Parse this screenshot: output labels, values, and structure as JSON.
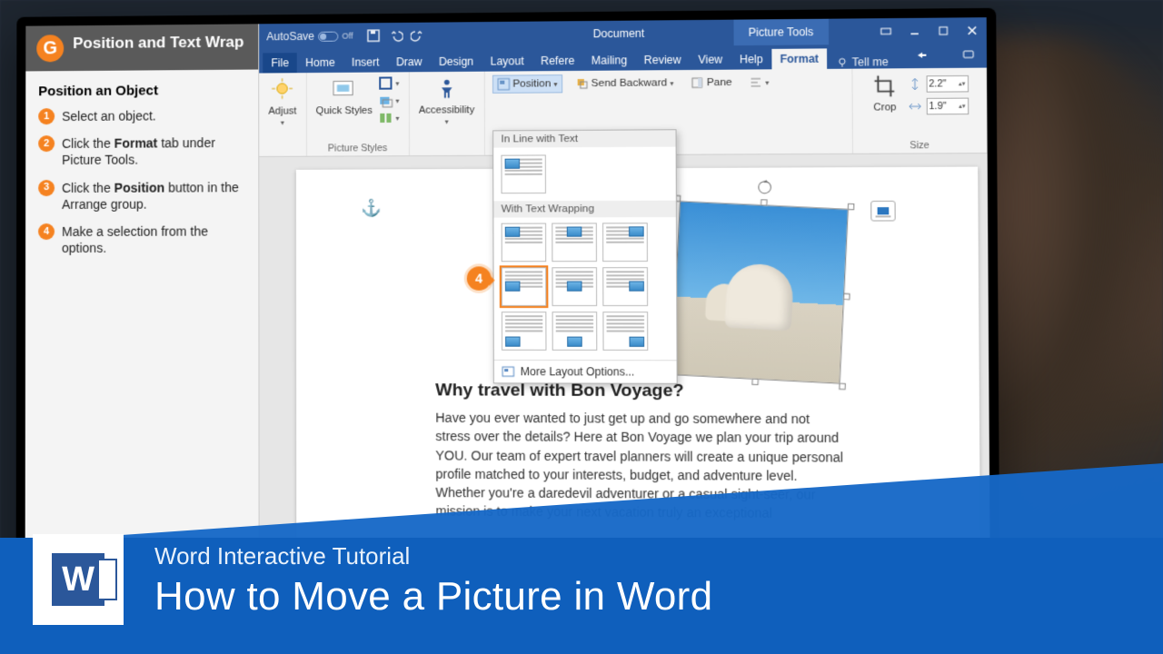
{
  "tutorial": {
    "title": "Position and Text Wrap",
    "section": "Position an Object",
    "steps": [
      {
        "n": "1",
        "text": "Select an object."
      },
      {
        "n": "2",
        "text_pre": "Click the ",
        "bold": "Format",
        "text_post": " tab under Picture Tools."
      },
      {
        "n": "3",
        "text_pre": "Click the ",
        "bold": "Position",
        "text_post": " button in the Arrange group."
      },
      {
        "n": "4",
        "text": "Make a selection from the options."
      }
    ]
  },
  "word": {
    "autosave_label": "AutoSave",
    "autosave_state": "Off",
    "doc_title": "Document",
    "context_tab": "Picture Tools",
    "tabs": [
      "File",
      "Home",
      "Insert",
      "Draw",
      "Design",
      "Layout",
      "Refere",
      "Mailing",
      "Review",
      "View",
      "Help",
      "Format"
    ],
    "active_tab": "Format",
    "tellme": "Tell me",
    "ribbon": {
      "adjust": "Adjust",
      "quick_styles": "Quick Styles",
      "picture_styles": "Picture Styles",
      "accessibility": "Accessibility",
      "position": "Position",
      "send_backward": "Send Backward",
      "selection_pane": "Pane",
      "crop": "Crop",
      "size": "Size",
      "height": "2.2\"",
      "width": "1.9\""
    },
    "position_menu": {
      "inline_label": "In Line with Text",
      "wrap_label": "With Text Wrapping",
      "more": "More Layout Options..."
    },
    "callout_step": "4",
    "document": {
      "heading": "Why travel with Bon Voyage?",
      "body": "Have you ever wanted to just get up and go somewhere and not stress over the details?  Here at Bon Voyage we plan your trip around YOU. Our team of expert travel planners will create a unique personal profile matched to your interests, budget, and adventure level. Whether you're a daredevil adventurer or a casual sight-seer, our mission is to make your next vacation truly an exceptional"
    }
  },
  "overlay": {
    "logo_letter": "W",
    "subtitle": "Word Interactive Tutorial",
    "title": "How to Move a Picture in Word"
  }
}
